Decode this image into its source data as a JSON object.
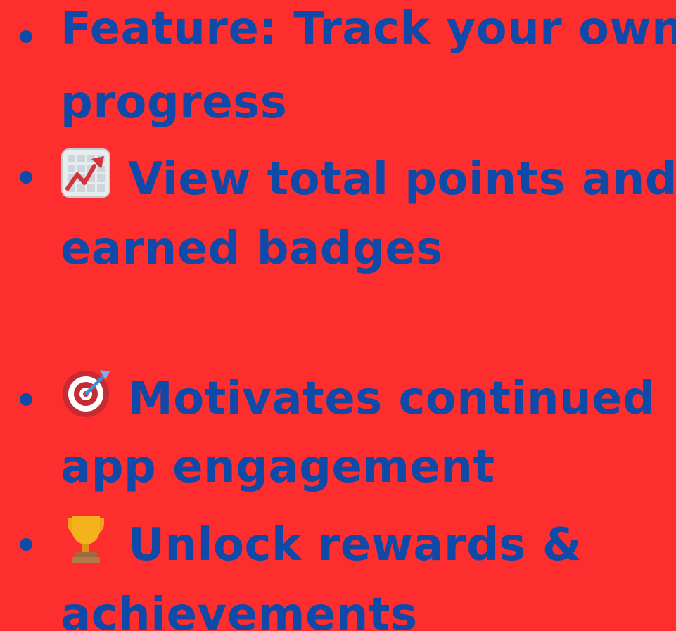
{
  "colors": {
    "background": "#fe2e2f",
    "text": "#0f4aa8",
    "bullet": "#0f4aa8"
  },
  "items": [
    {
      "icon": "",
      "line1": "Feature: Track your own",
      "line2": "progress"
    },
    {
      "icon": "chart-increasing-icon",
      "line1": "View total points and",
      "line2": "earned badges"
    },
    {
      "icon": "direct-hit-target-icon",
      "line1": "Motivates continued",
      "line2": "app engagement"
    },
    {
      "icon": "trophy-icon",
      "line1": "Unlock rewards &",
      "line2": "achievements"
    }
  ]
}
